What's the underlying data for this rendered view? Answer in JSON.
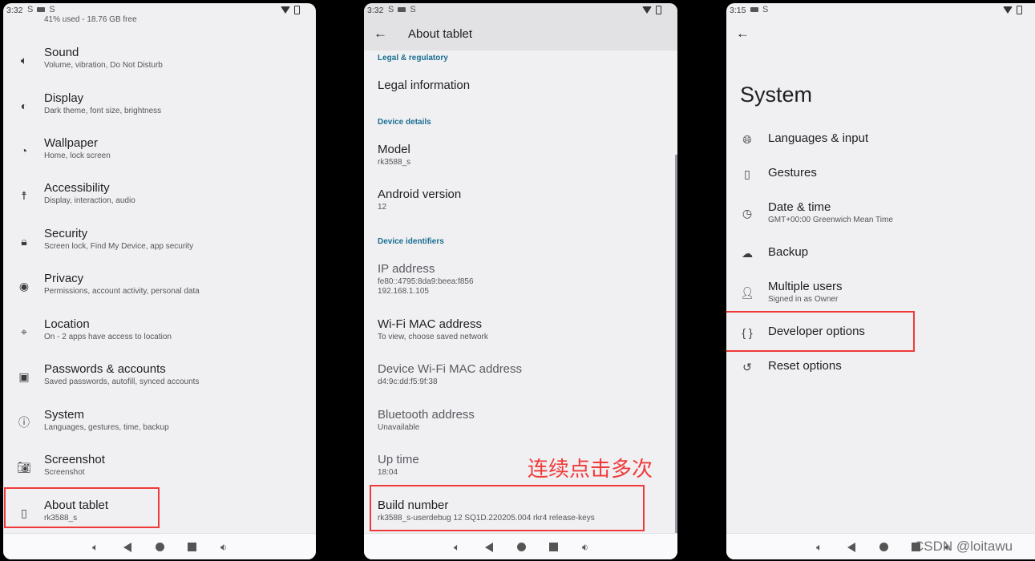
{
  "panels": {
    "settings": {
      "status": {
        "time": "3:32"
      },
      "storage_summary": "41% used - 18.76 GB free",
      "items": [
        {
          "icon": "volume-icon",
          "title": "Sound",
          "sub": "Volume, vibration, Do Not Disturb"
        },
        {
          "icon": "display-brightness-icon",
          "title": "Display",
          "sub": "Dark theme, font size, brightness"
        },
        {
          "icon": "palette-icon",
          "title": "Wallpaper",
          "sub": "Home, lock screen"
        },
        {
          "icon": "accessibility-icon",
          "title": "Accessibility",
          "sub": "Display, interaction, audio"
        },
        {
          "icon": "lock-icon",
          "title": "Security",
          "sub": "Screen lock, Find My Device, app security"
        },
        {
          "icon": "privacy-eye-icon",
          "title": "Privacy",
          "sub": "Permissions, account activity, personal data"
        },
        {
          "icon": "location-pin-icon",
          "title": "Location",
          "sub": "On - 2 apps have access to location"
        },
        {
          "icon": "account-box-icon",
          "title": "Passwords & accounts",
          "sub": "Saved passwords, autofill, synced accounts"
        },
        {
          "icon": "info-icon",
          "title": "System",
          "sub": "Languages, gestures, time, backup"
        },
        {
          "icon": "camera-icon",
          "title": "Screenshot",
          "sub": "Screenshot"
        },
        {
          "icon": "tablet-info-icon",
          "title": "About tablet",
          "sub": "rk3588_s"
        }
      ]
    },
    "about": {
      "status": {
        "time": "3:32"
      },
      "title": "About tablet",
      "sections": {
        "legal": "Legal & regulatory",
        "device_details": "Device details",
        "device_identifiers": "Device identifiers"
      },
      "legal_information": "Legal information",
      "model": {
        "title": "Model",
        "value": "rk3588_s"
      },
      "android_version": {
        "title": "Android version",
        "value": "12"
      },
      "ip_address": {
        "title": "IP address",
        "value1": "fe80::4795:8da9:beea:f856",
        "value2": "192.168.1.105"
      },
      "wifi_mac": {
        "title": "Wi-Fi MAC address",
        "value": "To view, choose saved network"
      },
      "device_wifi_mac": {
        "title": "Device Wi-Fi MAC address",
        "value": "d4:9c:dd:f5:9f:38"
      },
      "bluetooth": {
        "title": "Bluetooth address",
        "value": "Unavailable"
      },
      "up_time": {
        "title": "Up time",
        "value": "18:04"
      },
      "build_number": {
        "title": "Build number",
        "value": "rk3588_s-userdebug 12 SQ1D.220205.004 rkr4 release-keys"
      }
    },
    "system": {
      "status": {
        "time": "3:15"
      },
      "title": "System",
      "items": [
        {
          "icon": "globe-icon",
          "title": "Languages & input",
          "sub": ""
        },
        {
          "icon": "gestures-icon",
          "title": "Gestures",
          "sub": ""
        },
        {
          "icon": "clock-icon",
          "title": "Date & time",
          "sub": "GMT+00:00 Greenwich Mean Time"
        },
        {
          "icon": "cloud-upload-icon",
          "title": "Backup",
          "sub": ""
        },
        {
          "icon": "person-icon",
          "title": "Multiple users",
          "sub": "Signed in as Owner"
        },
        {
          "icon": "braces-icon",
          "title": "Developer options",
          "sub": ""
        },
        {
          "icon": "history-icon",
          "title": "Reset options",
          "sub": ""
        }
      ]
    }
  },
  "annotation": "连续点击多次",
  "watermark": "CSDN @loitawu",
  "colors": {
    "highlight": "#f03a3a",
    "section_header": "#1a6e91",
    "background": "#f0f0f3"
  }
}
